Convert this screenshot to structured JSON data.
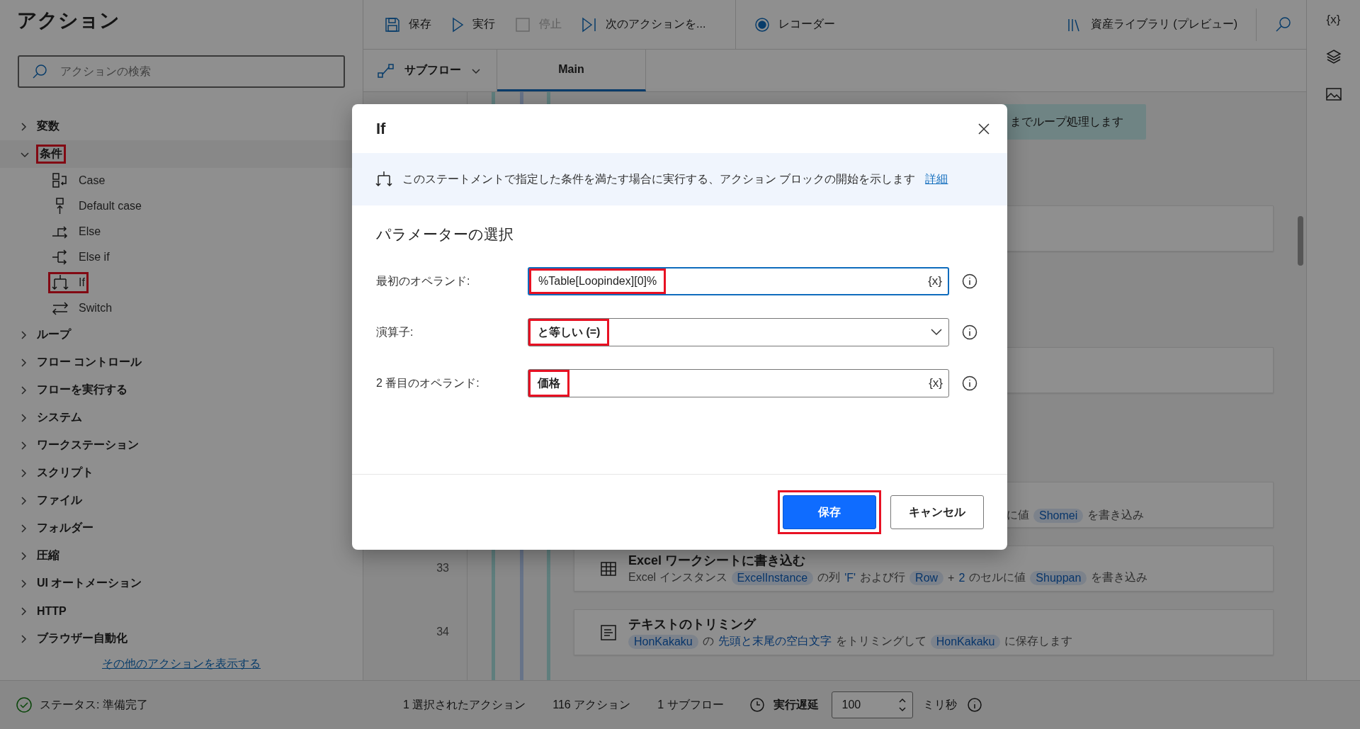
{
  "sidebar": {
    "title": "アクション",
    "search": {
      "placeholder": "アクションの検索"
    },
    "groups": [
      {
        "label": "変数",
        "expanded": false,
        "highlighted": false
      },
      {
        "label": "条件",
        "expanded": true,
        "highlighted": true,
        "children": [
          {
            "label": "Case",
            "kind": "case",
            "highlighted": false
          },
          {
            "label": "Default case",
            "kind": "default_case",
            "highlighted": false
          },
          {
            "label": "Else",
            "kind": "else",
            "highlighted": false
          },
          {
            "label": "Else if",
            "kind": "else_if",
            "highlighted": false
          },
          {
            "label": "If",
            "kind": "if",
            "highlighted": true
          },
          {
            "label": "Switch",
            "kind": "switch",
            "highlighted": false
          }
        ]
      },
      {
        "label": "ループ",
        "expanded": false,
        "highlighted": false
      },
      {
        "label": "フロー コントロール",
        "expanded": false,
        "highlighted": false
      },
      {
        "label": "フローを実行する",
        "expanded": false,
        "highlighted": false
      },
      {
        "label": "システム",
        "expanded": false,
        "highlighted": false
      },
      {
        "label": "ワークステーション",
        "expanded": false,
        "highlighted": false
      },
      {
        "label": "スクリプト",
        "expanded": false,
        "highlighted": false
      },
      {
        "label": "ファイル",
        "expanded": false,
        "highlighted": false
      },
      {
        "label": "フォルダー",
        "expanded": false,
        "highlighted": false
      },
      {
        "label": "圧縮",
        "expanded": false,
        "highlighted": false
      },
      {
        "label": "UI オートメーション",
        "expanded": false,
        "highlighted": false
      },
      {
        "label": "HTTP",
        "expanded": false,
        "highlighted": false
      },
      {
        "label": "ブラウザー自動化",
        "expanded": false,
        "highlighted": false
      }
    ],
    "more_link": "その他のアクションを表示する"
  },
  "toolbar": {
    "buttons": [
      {
        "label": "保存",
        "kind": "save",
        "disabled": false
      },
      {
        "label": "実行",
        "kind": "run",
        "disabled": false
      },
      {
        "label": "停止",
        "kind": "stop",
        "disabled": true
      },
      {
        "label": "次のアクションを...",
        "kind": "next",
        "disabled": false
      },
      {
        "label": "レコーダー",
        "kind": "recorder",
        "disabled": false
      }
    ],
    "library": "資産ライブラリ (プレビュー)"
  },
  "subflow": {
    "dropdown": "サブフロー",
    "tabs": [
      {
        "label": "Main",
        "selected": true
      }
    ]
  },
  "canvas": {
    "banner": "までループ処理します",
    "steps": [
      {
        "kind": "covered"
      },
      {
        "kind": "covered"
      },
      {
        "kind": "covered",
        "description": [
          {
            "text": "に値",
            "kind": "plain"
          },
          {
            "text": "Shomei",
            "kind": "variable"
          },
          {
            "text": "を書き込み",
            "kind": "plain"
          }
        ]
      },
      {
        "kind": "excel",
        "number": "33",
        "title": "Excel ワークシートに書き込む",
        "description": [
          {
            "text": "Excel インスタンス",
            "kind": "plain"
          },
          {
            "text": "ExcelInstance",
            "kind": "variable"
          },
          {
            "text": "の列",
            "kind": "plain"
          },
          {
            "text": "'F'",
            "kind": "literal"
          },
          {
            "text": "および行",
            "kind": "plain"
          },
          {
            "text": "Row",
            "kind": "variable"
          },
          {
            "text": "+",
            "kind": "plain"
          },
          {
            "text": "2",
            "kind": "literal"
          },
          {
            "text": "のセルに値",
            "kind": "plain"
          },
          {
            "text": "Shuppan",
            "kind": "variable"
          },
          {
            "text": "を書き込み",
            "kind": "plain"
          }
        ]
      },
      {
        "kind": "text",
        "number": "34",
        "title": "テキストのトリミング",
        "description": [
          {
            "text": "HonKakaku",
            "kind": "variable"
          },
          {
            "text": "の",
            "kind": "plain"
          },
          {
            "text": "先頭と末尾の空白文字",
            "kind": "literal"
          },
          {
            "text": "をトリミングして",
            "kind": "plain"
          },
          {
            "text": "HonKakaku",
            "kind": "variable"
          },
          {
            "text": "に保存します",
            "kind": "plain"
          }
        ]
      }
    ]
  },
  "rail": {
    "variables": "{x}"
  },
  "status_bar": {
    "status": "ステータス: 準備完了",
    "selected_actions": "1 選択されたアクション",
    "actions": "116 アクション",
    "subflows": "1 サブフロー",
    "delay_label": "実行遅延",
    "delay_value": "100",
    "delay_unit": "ミリ秒"
  },
  "dialog": {
    "title": "If",
    "description": "このステートメントで指定した条件を満たす場合に実行する、アクション ブロックの開始を示します",
    "details_link": "詳細",
    "section": "パラメーターの選択",
    "fields": [
      {
        "label": "最初のオペランド:",
        "value": "%Table[Loopindex][0]%",
        "kind": "text",
        "focused": true,
        "highlighted": true,
        "variable_button": "{x}"
      },
      {
        "label": "演算子:",
        "value": "と等しい (=)",
        "kind": "dropdown",
        "focused": false,
        "highlighted": true
      },
      {
        "label": "2 番目のオペランド:",
        "value": "価格",
        "kind": "text",
        "focused": false,
        "highlighted": true,
        "variable_button": "{x}"
      }
    ],
    "buttons": [
      {
        "label": "保存",
        "kind": "primary",
        "highlighted": true
      },
      {
        "label": "キャンセル",
        "kind": "secondary",
        "highlighted": false
      }
    ]
  }
}
